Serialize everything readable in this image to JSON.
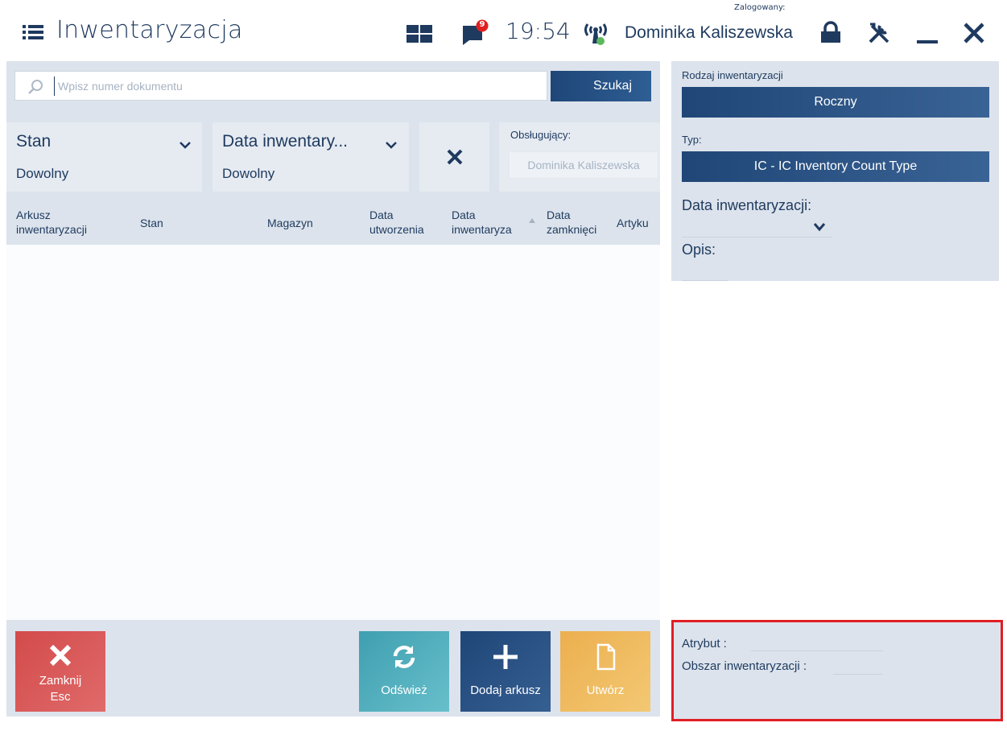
{
  "header": {
    "title": "Inwentaryzacja",
    "time": "19:54",
    "notification_count": "9",
    "logged_in_label": "Zalogowany:",
    "user_name": "Dominika Kaliszewska"
  },
  "search": {
    "placeholder": "Wpisz numer dokumentu",
    "value": "",
    "button_label": "Szukaj"
  },
  "filters": {
    "stan_label": "Stan",
    "stan_value": "Dowolny",
    "data_label": "Data inwentary...",
    "data_value": "Dowolny",
    "operator_label": "Obsługujący:",
    "operator_value": "Dominika Kaliszewska"
  },
  "table": {
    "columns": [
      {
        "line1": "Arkusz",
        "line2": "inwentaryzacji"
      },
      {
        "line1": "Stan",
        "line2": ""
      },
      {
        "line1": "Magazyn",
        "line2": ""
      },
      {
        "line1": "Data",
        "line2": "utworzenia"
      },
      {
        "line1": "Data",
        "line2": "inwentaryza"
      },
      {
        "line1": "Data",
        "line2": "zamknięci"
      },
      {
        "line1": "Artyku",
        "line2": ""
      }
    ],
    "rows": []
  },
  "toolbar": {
    "close_label": "Zamknij",
    "close_shortcut": "Esc",
    "refresh_label": "Odśwież",
    "add_sheet_label": "Dodaj arkusz",
    "create_label": "Utwórz"
  },
  "details": {
    "kind_label": "Rodzaj inwentaryzacji",
    "kind_value": "Roczny",
    "type_label": "Typ:",
    "type_value": "IC - IC Inventory Count Type",
    "date_label": "Data inwentaryzacji:",
    "description_label": "Opis:"
  },
  "attributes": {
    "attribute_label": "Atrybut :",
    "area_label": "Obszar inwentaryzacji :"
  },
  "colors": {
    "primary": "#1f4677",
    "close_button": "#d34b4b",
    "refresh_button": "#3f9fb0",
    "create_button": "#ecaf4f",
    "highlight_border": "#e01e24",
    "notification_badge": "#e02020",
    "signal_dot": "#5cb85c"
  }
}
